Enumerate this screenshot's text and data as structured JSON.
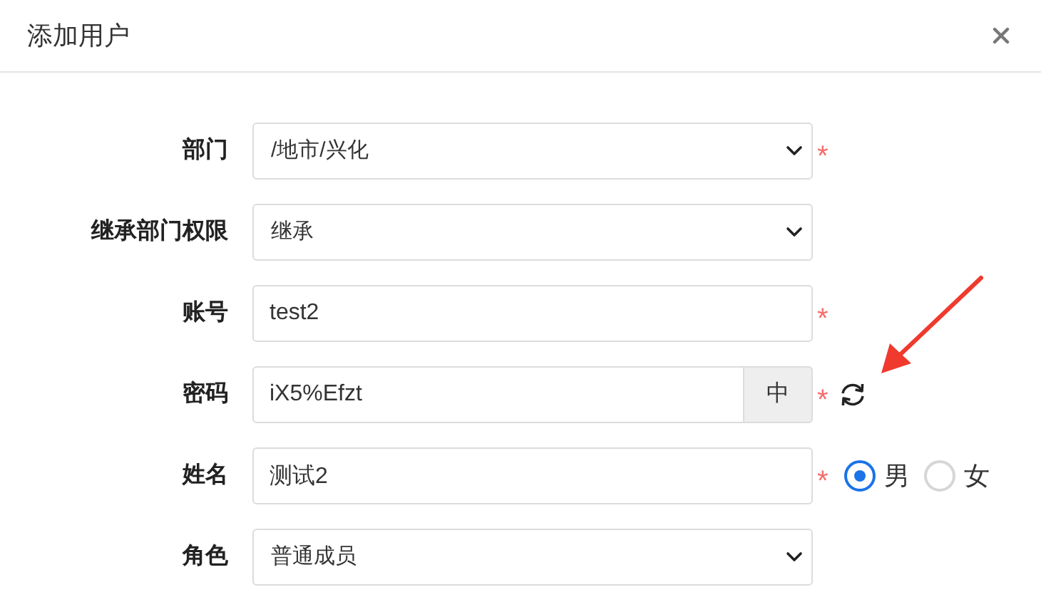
{
  "dialog": {
    "title": "添加用户"
  },
  "fields": [
    {
      "kind": "select",
      "label": "部门",
      "value": "/地市/兴化",
      "required_mark": "*"
    },
    {
      "kind": "select",
      "label": "继承部门权限",
      "value": "继承"
    },
    {
      "kind": "input",
      "label": "账号",
      "value": "test2",
      "required_mark": "*"
    },
    {
      "kind": "password",
      "label": "密码",
      "value": "iX5%Efzt",
      "strength": "中",
      "required_mark": "*"
    },
    {
      "kind": "name",
      "label": "姓名",
      "value": "测试2",
      "required_mark": "*",
      "options": [
        {
          "label": "男",
          "selected": true
        },
        {
          "label": "女",
          "selected": false
        }
      ]
    },
    {
      "kind": "select",
      "label": "角色",
      "value": "普通成员"
    }
  ]
}
